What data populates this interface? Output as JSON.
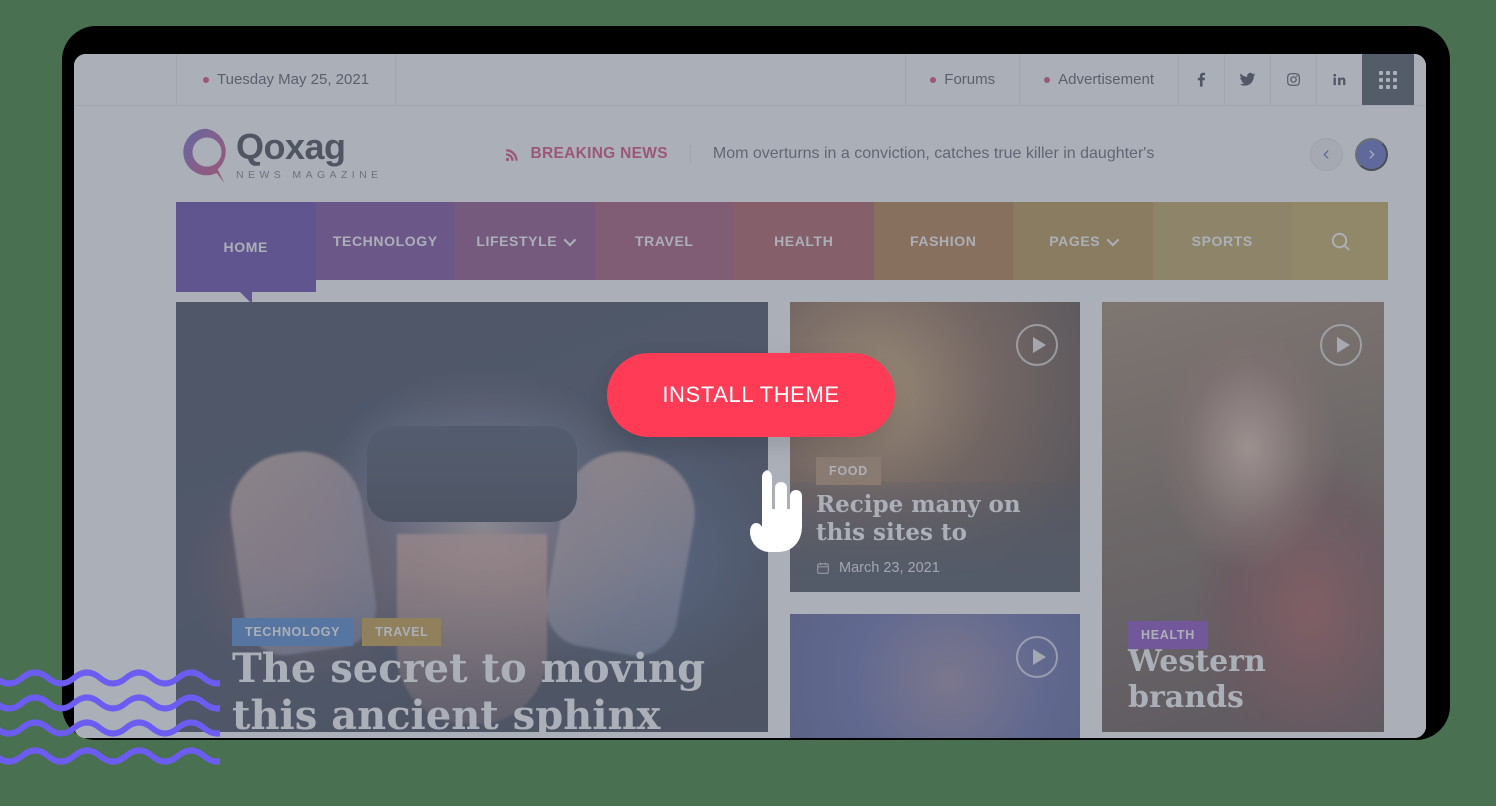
{
  "topbar": {
    "date": "Tuesday May 25, 2021",
    "links": [
      {
        "label": "Forums"
      },
      {
        "label": "Advertisement"
      }
    ],
    "social": [
      {
        "name": "facebook-icon"
      },
      {
        "name": "twitter-icon"
      },
      {
        "name": "instagram-icon"
      },
      {
        "name": "linkedin-icon"
      }
    ],
    "apps_label": "apps-grid-icon"
  },
  "masthead": {
    "logo_name": "Qoxag",
    "logo_sub": "NEWS MAGAZINE",
    "breaking_label": "BREAKING NEWS",
    "breaking_text": "Mom overturns in a conviction, catches true killer in daughter's",
    "prev_label": "‹",
    "next_label": "›"
  },
  "nav": {
    "items": [
      {
        "label": "HOME",
        "color": "#3a1494",
        "caret": false,
        "active": true
      },
      {
        "label": "TECHNOLOGY",
        "color": "#5b1b84",
        "caret": false,
        "active": false
      },
      {
        "label": "LIFESTYLE",
        "color": "#75206b",
        "caret": true,
        "active": false
      },
      {
        "label": "TRAVEL",
        "color": "#8e2753",
        "caret": false,
        "active": false
      },
      {
        "label": "HEALTH",
        "color": "#9b2f34",
        "caret": false,
        "active": false
      },
      {
        "label": "FASHION",
        "color": "#a25b16",
        "caret": false,
        "active": false
      },
      {
        "label": "PAGES",
        "color": "#a9791c",
        "caret": true,
        "active": false
      },
      {
        "label": "SPORTS",
        "color": "#b08f33",
        "caret": false,
        "active": false
      }
    ],
    "search_icon": "search-icon"
  },
  "hero": {
    "badges": [
      {
        "label": "TECHNOLOGY",
        "color": "#2468c4"
      },
      {
        "label": "TRAVEL",
        "color": "#b98412"
      }
    ],
    "title": "The secret to moving this ancient sphinx"
  },
  "cards": {
    "mid_top": {
      "badge": {
        "label": "FOOD",
        "color": "#a5764b"
      },
      "title": "Recipe many on this sites to",
      "date": "March 23, 2021",
      "play_icon": "play-icon"
    },
    "mid_bottom": {
      "play_icon": "play-icon"
    },
    "right": {
      "badge": {
        "label": "HEALTH",
        "color": "#6a19b5"
      },
      "title": "Western brands",
      "play_icon": "play-icon"
    }
  },
  "overlay": {
    "cta_label": "INSTALL THEME",
    "cta_color": "#ff3b55",
    "cursor_icon": "hand-pointer-cursor"
  },
  "decor": {
    "wave_color": "#6c5cf2"
  }
}
